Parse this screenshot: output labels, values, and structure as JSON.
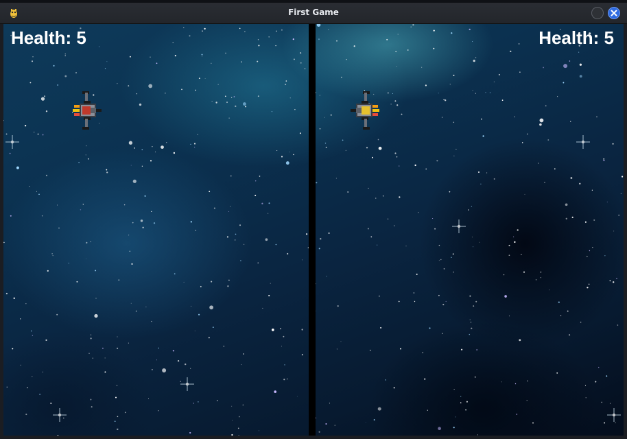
{
  "window": {
    "title": "First Game",
    "app_icon": "pygame-snake-icon",
    "controls": [
      "minimize-icon",
      "close-icon"
    ],
    "close_color": "#2f6be0"
  },
  "game": {
    "background": "starfield",
    "divider_color": "#000000",
    "players": [
      {
        "side": "left",
        "health_label": "Health: 5",
        "ship_icon": "spaceship-red-icon",
        "ship_color": "#c0392b",
        "facing": "right"
      },
      {
        "side": "right",
        "health_label": "Health: 5",
        "ship_icon": "spaceship-yellow-icon",
        "ship_color": "#e6c12e",
        "facing": "left"
      }
    ]
  }
}
